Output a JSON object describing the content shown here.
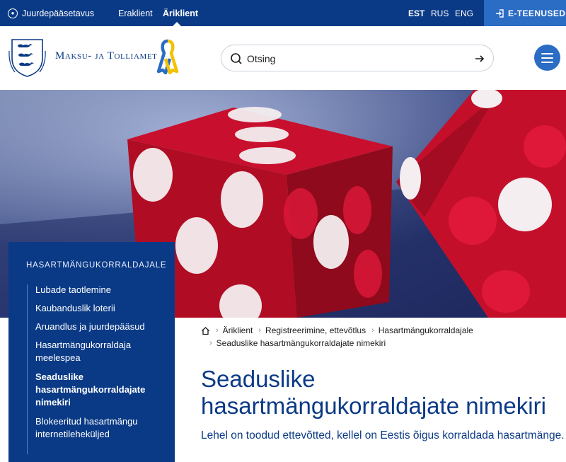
{
  "topbar": {
    "accessibility_label": "Juurdepääsetavus",
    "audiences": [
      "Eraklient",
      "Äriklient"
    ],
    "languages": [
      "EST",
      "RUS",
      "ENG"
    ],
    "eservices_label": "E-TEENUSED"
  },
  "header": {
    "logo_text": "Maksu- ja Tolliamet",
    "search_placeholder": "Otsing"
  },
  "sidebar": {
    "heading": "HASARTMÄNGUKORRALDAJALE",
    "items": [
      {
        "label": "Lubade taotlemine"
      },
      {
        "label": "Kaubanduslik loterii"
      },
      {
        "label": "Aruandlus ja juurdepääsud"
      },
      {
        "label": "Hasartmängukorraldaja meelespea"
      },
      {
        "label": "Seaduslike hasartmängukorraldajate nimekiri"
      },
      {
        "label": "Blokeeritud hasartmängu internetileheküljed"
      }
    ]
  },
  "breadcrumb": [
    "Äriklient",
    "Registreerimine, ettevõtlus",
    "Hasartmängukorraldajale",
    "Seaduslike hasartmängukorraldajate nimekiri"
  ],
  "page": {
    "title": "Seaduslike hasartmängukorraldajate nimekiri",
    "lead": "Lehel on toodud ettevõtted, kellel on Eestis õigus korraldada hasartmänge."
  },
  "colors": {
    "primary": "#0a3a86",
    "accent": "#2b6cc4"
  }
}
